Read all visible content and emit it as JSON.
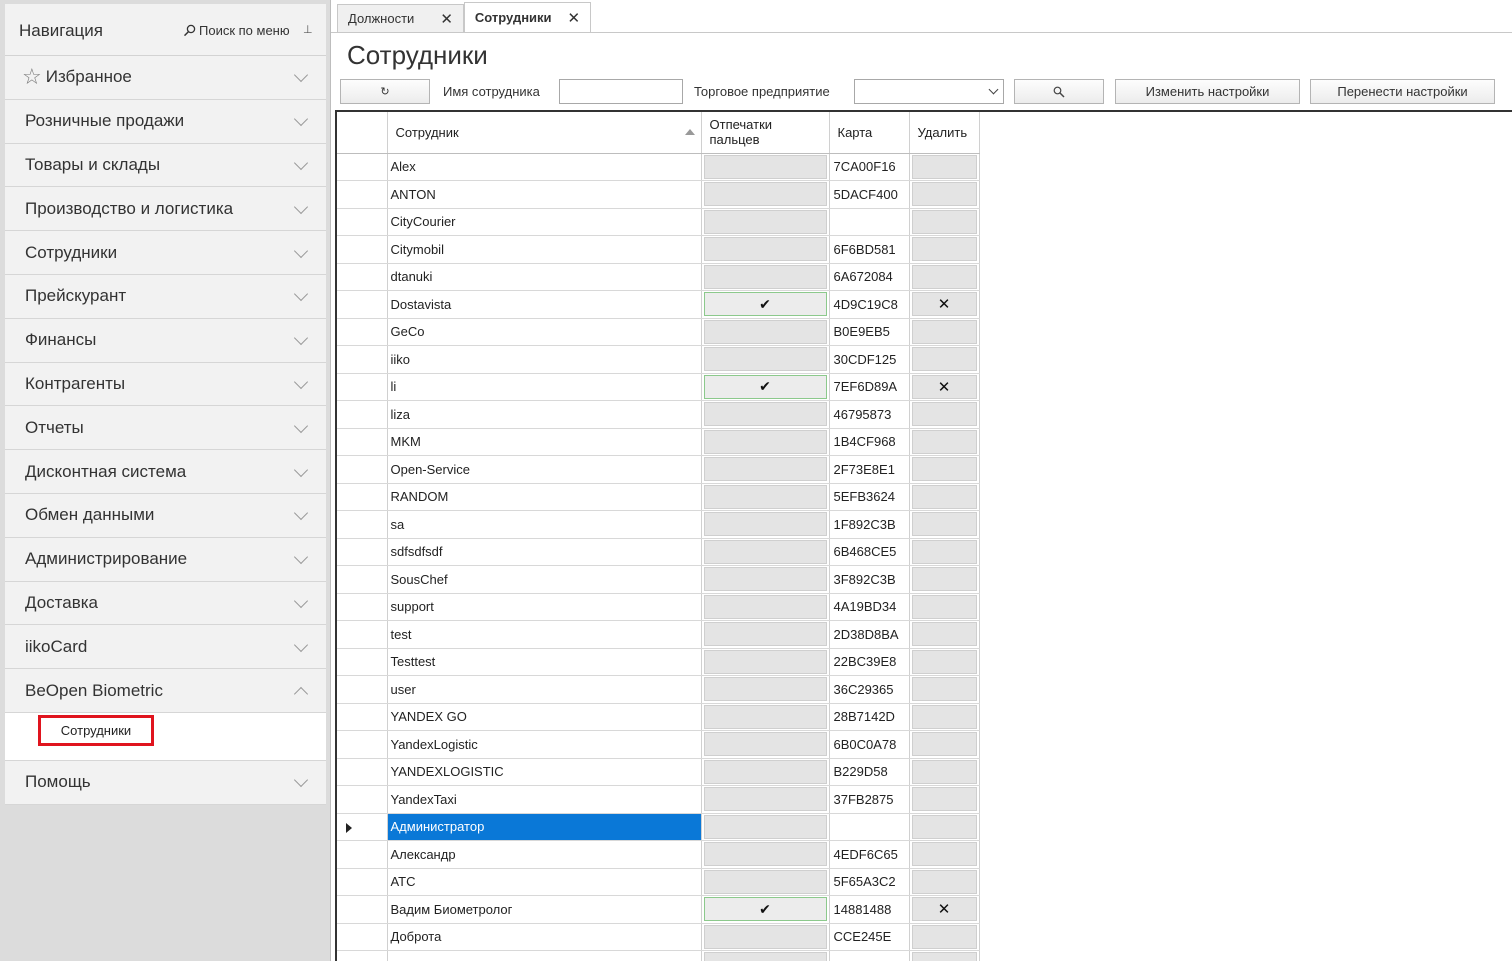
{
  "sidebar": {
    "title": "Навигация",
    "search_label": "Поиск по меню",
    "favorites": "Избранное",
    "items": [
      {
        "label": "Розничные продажи"
      },
      {
        "label": "Товары и склады"
      },
      {
        "label": "Производство и логистика"
      },
      {
        "label": "Сотрудники"
      },
      {
        "label": "Прейскурант"
      },
      {
        "label": "Финансы"
      },
      {
        "label": "Контрагенты"
      },
      {
        "label": "Отчеты"
      },
      {
        "label": "Дисконтная система"
      },
      {
        "label": "Обмен данными"
      },
      {
        "label": "Администрирование"
      },
      {
        "label": "Доставка"
      },
      {
        "label": "iikoCard"
      },
      {
        "label": "BeOpen Biometric"
      }
    ],
    "subitem": "Сотрудники",
    "help": "Помощь"
  },
  "tabs": [
    {
      "label": "Должности"
    },
    {
      "label": "Сотрудники"
    }
  ],
  "page_title": "Сотрудники",
  "toolbar": {
    "refresh_glyph": "↻",
    "employee_name_label": "Имя сотрудника",
    "employee_name_value": "",
    "enterprise_label": "Торговое предприятие",
    "enterprise_value": "",
    "search_glyph": "🔍",
    "change_settings": "Изменить настройки",
    "transfer_settings": "Перенести настройки"
  },
  "grid": {
    "columns": {
      "employee": "Сотрудник",
      "fingerprints_line1": "Отпечатки",
      "fingerprints_line2": "пальцев",
      "card": "Карта",
      "delete": "Удалить"
    },
    "rows": [
      {
        "name": "Alex",
        "card": "7CA00F16",
        "fp": false
      },
      {
        "name": "ANTON",
        "card": "5DACF400",
        "fp": false
      },
      {
        "name": "CityCourier",
        "card": "",
        "fp": false
      },
      {
        "name": "Citymobil",
        "card": "6F6BD581",
        "fp": false
      },
      {
        "name": "dtanuki",
        "card": "6A672084",
        "fp": false
      },
      {
        "name": "Dostavista",
        "card": "4D9C19C8",
        "fp": true
      },
      {
        "name": "GeCo",
        "card": "B0E9EB5",
        "fp": false
      },
      {
        "name": "iiko",
        "card": "30CDF125",
        "fp": false
      },
      {
        "name": "li",
        "card": "7EF6D89A",
        "fp": true
      },
      {
        "name": "liza",
        "card": "46795873",
        "fp": false
      },
      {
        "name": "MKM",
        "card": "1B4CF968",
        "fp": false
      },
      {
        "name": "Open-Service",
        "card": "2F73E8E1",
        "fp": false
      },
      {
        "name": "RANDOM",
        "card": "5EFB3624",
        "fp": false
      },
      {
        "name": "sa",
        "card": "1F892C3B",
        "fp": false
      },
      {
        "name": "sdfsdfsdf",
        "card": "6B468CE5",
        "fp": false
      },
      {
        "name": "SousChef",
        "card": "3F892C3B",
        "fp": false
      },
      {
        "name": "support",
        "card": "4A19BD34",
        "fp": false
      },
      {
        "name": "test",
        "card": "2D38D8BA",
        "fp": false
      },
      {
        "name": "Testtest",
        "card": "22BC39E8",
        "fp": false
      },
      {
        "name": "user",
        "card": "36C29365",
        "fp": false
      },
      {
        "name": "YANDEX GO",
        "card": "28B7142D",
        "fp": false
      },
      {
        "name": "YandexLogistic",
        "card": "6B0C0A78",
        "fp": false
      },
      {
        "name": "YANDEXLOGISTIC",
        "card": "B229D58",
        "fp": false
      },
      {
        "name": "YandexTaxi",
        "card": "37FB2875",
        "fp": false
      },
      {
        "name": "Администратор",
        "card": "",
        "fp": false,
        "selected": true
      },
      {
        "name": "Александр",
        "card": "4EDF6C65",
        "fp": false
      },
      {
        "name": "АТС",
        "card": "5F65A3C2",
        "fp": false
      },
      {
        "name": "Вадим Биометролог",
        "card": "14881488",
        "fp": true
      },
      {
        "name": "Доброта",
        "card": "CCE245E",
        "fp": false
      },
      {
        "name": "",
        "card": "",
        "fp": false
      }
    ],
    "check_glyph": "✔",
    "delete_glyph": "✕"
  },
  "colors": {
    "selection": "#0a78d7",
    "highlight_box": "#e0141e",
    "checked_border": "#8cc98c"
  }
}
